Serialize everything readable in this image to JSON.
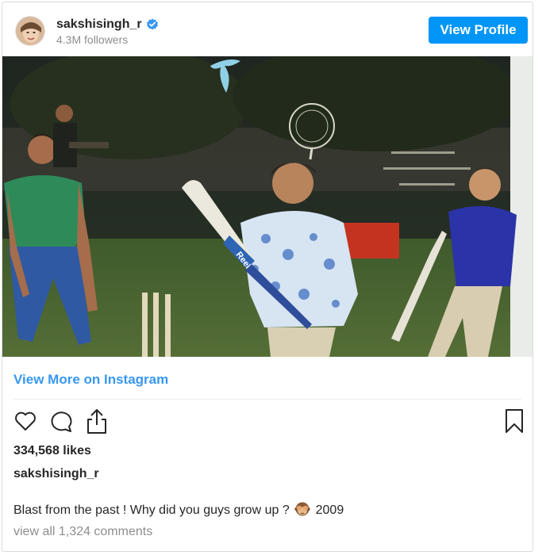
{
  "header": {
    "username": "sakshisingh_r",
    "followers": "4.3M followers",
    "view_profile_label": "View Profile",
    "verified_icon": "verified-badge-icon"
  },
  "post": {
    "photo_bat_brand": "Reebok",
    "view_more_label": "View More on Instagram",
    "likes": "334,568 likes",
    "caption_user": "sakshisingh_r",
    "caption_text_before": "Blast from the past ! Why did you guys grow up ?",
    "caption_emoji": "see-no-evil-monkey-emoji",
    "caption_text_after": "2009",
    "comments": "view all 1,324 comments"
  },
  "actions": {
    "like_icon": "heart-icon",
    "comment_icon": "comment-icon",
    "share_icon": "share-icon",
    "save_icon": "bookmark-icon"
  },
  "colors": {
    "accent": "#0095f6",
    "link": "#3897f0",
    "verified": "#3897f0",
    "muted": "#8e8e8e"
  }
}
